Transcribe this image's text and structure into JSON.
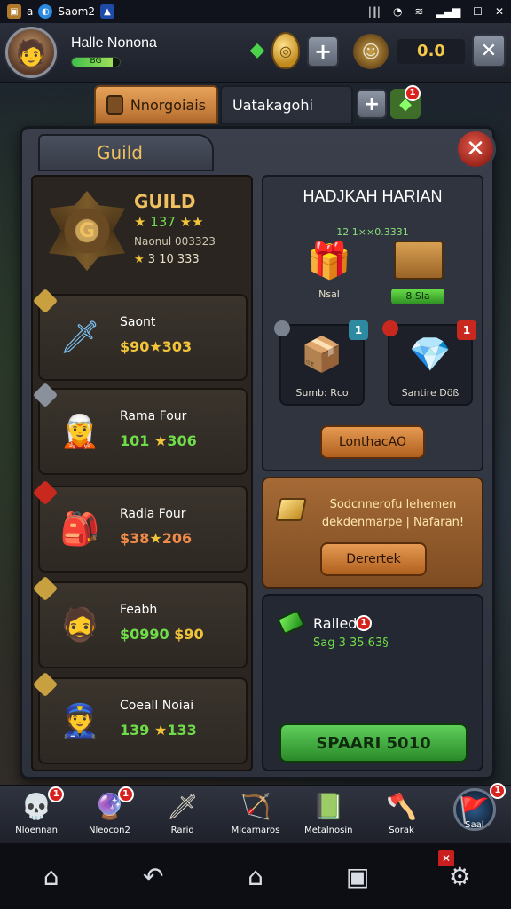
{
  "status_bar": {
    "app_label": "Saom2",
    "icons": [
      "chest-icon",
      "game-icon",
      "app-icon"
    ],
    "right_icons": [
      "sim-icon",
      "alarm-icon",
      "wifi-icon",
      "signal-icon",
      "window-icon",
      "close-icon"
    ]
  },
  "player": {
    "name": "Halle Nonona",
    "xp_text": "BG",
    "xp_fraction": 0.85,
    "top_value": "0.0"
  },
  "tabs": [
    {
      "label": "Nnorgoiais",
      "active": true
    },
    {
      "label": "Uatakagohi",
      "active": false
    }
  ],
  "tab_badge": "1",
  "modal": {
    "title": "Guild",
    "close_icon": "close-icon"
  },
  "guild": {
    "title": "GUILD",
    "emblem_letter": "G",
    "line1": "137",
    "line2": "Naonul 003323",
    "line3": "3 10 333"
  },
  "members": [
    {
      "name": "Saont",
      "value": "$90",
      "value2": "303",
      "color": "#f2c43a",
      "icon": "sword-icon"
    },
    {
      "name": "Rama Four",
      "value": "101",
      "value2": "306",
      "color": "#6fdc4a",
      "icon": "hero-icon"
    },
    {
      "name": "Radia Four",
      "value": "$38",
      "value2": "206",
      "color": "#f08a4a",
      "icon": "backpack-icon"
    },
    {
      "name": "Feabh",
      "value": "$0990",
      "value2": "$90",
      "color": "#6fdc4a",
      "icon": "warrior-portrait-icon"
    },
    {
      "name": "Coeall Noiai",
      "value": "139",
      "value2": "133",
      "color": "#6fdc4a",
      "icon": "captain-portrait-icon"
    }
  ],
  "daily": {
    "title": "HADJKAH HARIAN",
    "subtitle": "12 1××0.3331",
    "reward_a_label": "Nsal",
    "reward_b_label": "8 Sla",
    "slots": [
      {
        "label": "Sumb: Rco",
        "badge": "1",
        "badge_color": "#2d8aa0",
        "corner_color": "#7a8290",
        "icon": "chest-icon"
      },
      {
        "label": "Santire Döß",
        "badge": "1",
        "badge_color": "#c8281e",
        "corner_color": "#c8281e",
        "icon": "gem-icon"
      }
    ],
    "button": "LonthacAO"
  },
  "promo": {
    "text": "Sodcnnerofu lehemen dekdenmarpe | Nafaran!",
    "button": "Derertek"
  },
  "raid": {
    "title": "Railed",
    "badge": "1",
    "subtitle": "Sag 3 35.63§",
    "button": "SPAARI 5010"
  },
  "bottom_nav": [
    {
      "label": "Nloennan",
      "icon": "skull-icon",
      "badge": "1"
    },
    {
      "label": "Nleocon2",
      "icon": "orb-icon",
      "badge": "1"
    },
    {
      "label": "Rarid",
      "icon": "sword-icon",
      "badge": ""
    },
    {
      "label": "Mlcarnaros",
      "icon": "crossbow-icon",
      "badge": ""
    },
    {
      "label": "Metalnosin",
      "icon": "book-icon",
      "badge": ""
    },
    {
      "label": "Sorak",
      "icon": "axe-icon",
      "badge": ""
    },
    {
      "label": "Saal",
      "icon": "banner-icon",
      "badge": "1",
      "active": true
    }
  ],
  "system_nav": [
    "home-icon",
    "back-icon",
    "home-outline-icon",
    "recent-icon",
    "bug-icon"
  ]
}
